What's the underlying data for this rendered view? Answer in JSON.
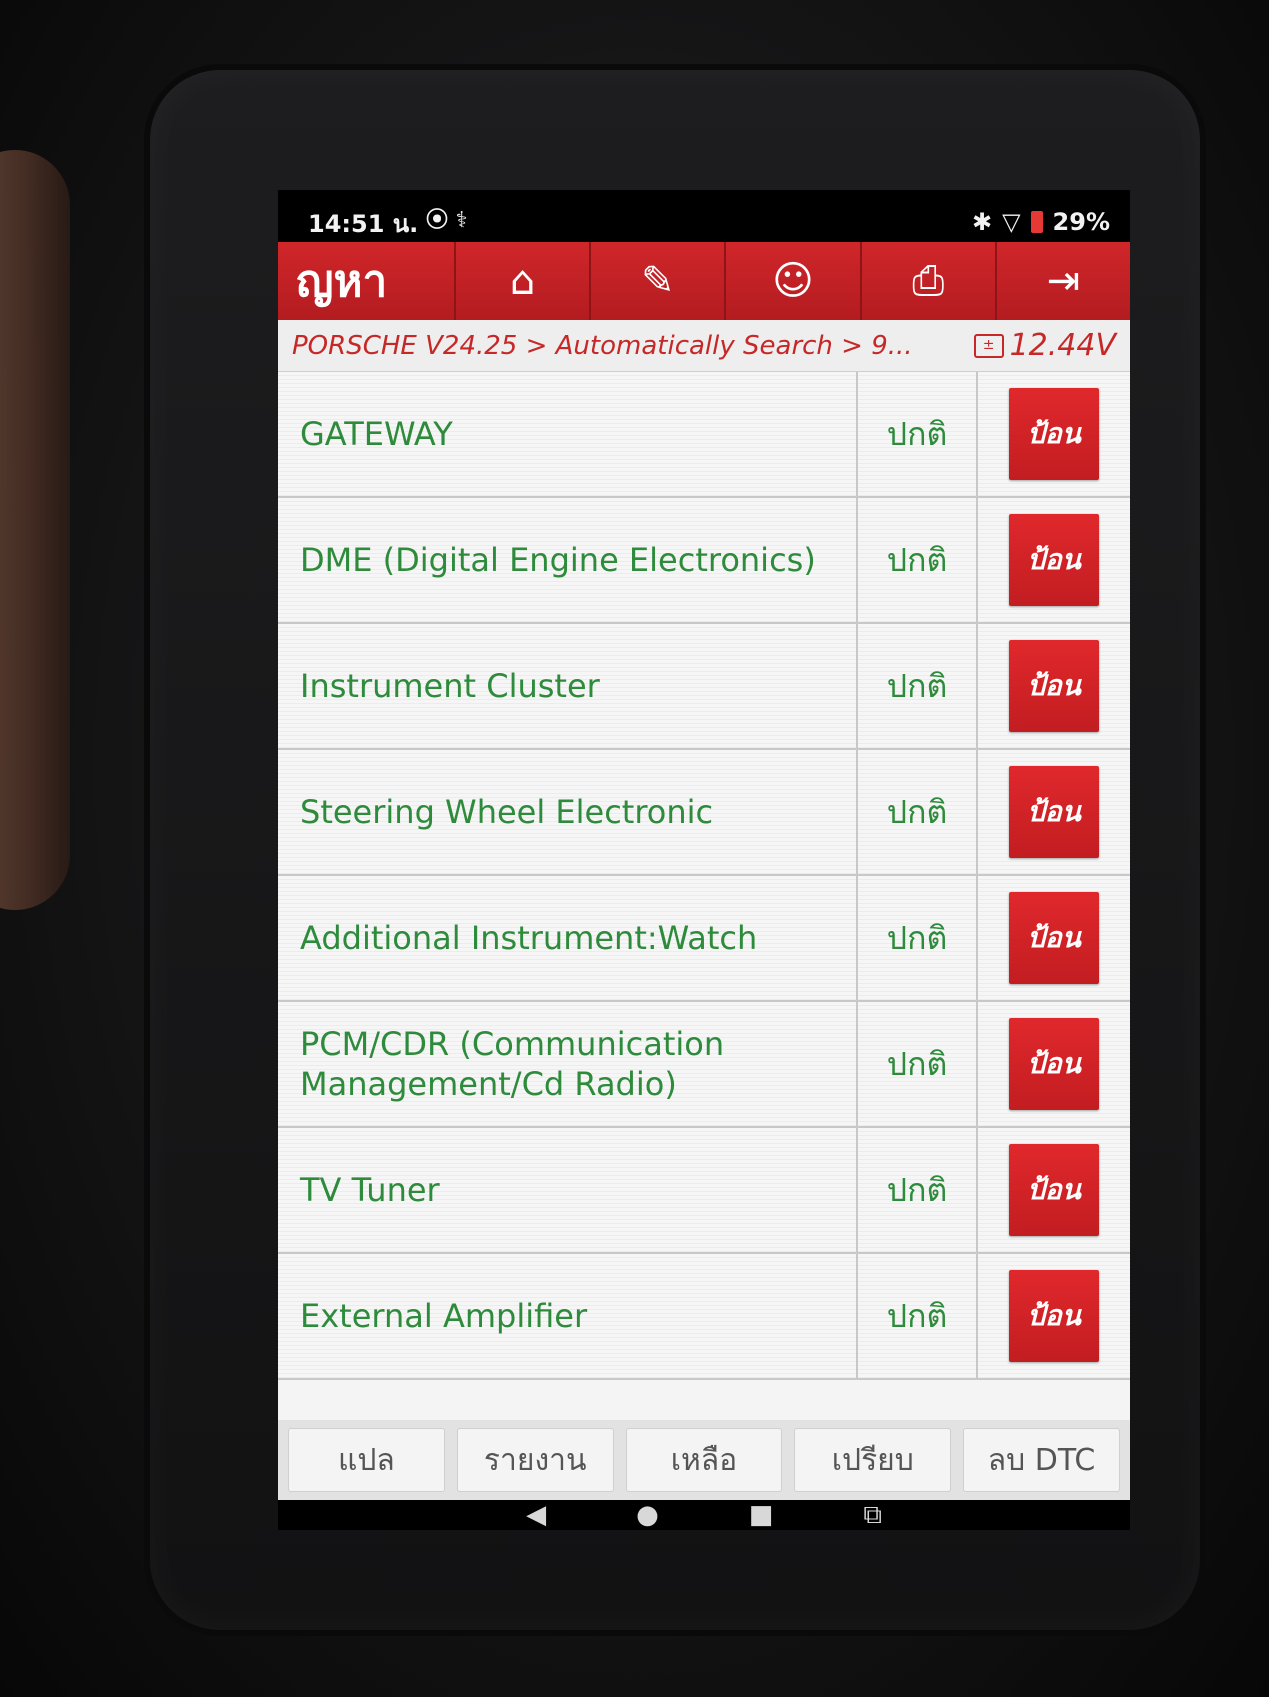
{
  "status_bar": {
    "time": "14:51 น.",
    "left_icons": [
      "usb-debug-icon",
      "vci-icon"
    ],
    "left_icons_glyphs": "⦿ ⚕",
    "bluetooth": "✱",
    "wifi": "▽",
    "battery": "29%"
  },
  "toolbar": {
    "title": "ญหา",
    "icons": [
      "home-icon",
      "edit-icon",
      "support-icon",
      "print-icon",
      "exit-icon"
    ],
    "glyphs": {
      "home": "⌂",
      "edit": "✎",
      "support": "☺",
      "print": "⎙",
      "exit": "⇥"
    }
  },
  "breadcrumb": {
    "path": "PORSCHE V24.25 > Automatically Search > 9...",
    "voltage": "12.44V"
  },
  "systems": [
    {
      "name": "GATEWAY",
      "status": "ปกติ",
      "action": "ป้อน"
    },
    {
      "name": "DME (Digital Engine Electronics)",
      "status": "ปกติ",
      "action": "ป้อน"
    },
    {
      "name": "Instrument Cluster",
      "status": "ปกติ",
      "action": "ป้อน"
    },
    {
      "name": "Steering Wheel Electronic",
      "status": "ปกติ",
      "action": "ป้อน"
    },
    {
      "name": "Additional Instrument:Watch",
      "status": "ปกติ",
      "action": "ป้อน"
    },
    {
      "name": "PCM/CDR (Communication Management/Cd Radio)",
      "status": "ปกติ",
      "action": "ป้อน"
    },
    {
      "name": "TV Tuner",
      "status": "ปกติ",
      "action": "ป้อน"
    },
    {
      "name": "External Amplifier",
      "status": "ปกติ",
      "action": "ป้อน"
    }
  ],
  "function_bar": {
    "translate": "แปล",
    "report": "รายงาน",
    "remaining": "เหลือ",
    "compare": "เปรียบ",
    "clear_dtc": "ลบ DTC"
  },
  "nav_bar": {
    "back": "◀",
    "home": "●",
    "recents": "■",
    "screenshot": "⧉"
  },
  "colors": {
    "accent": "#c62828",
    "status_text": "#2e8b3c"
  }
}
